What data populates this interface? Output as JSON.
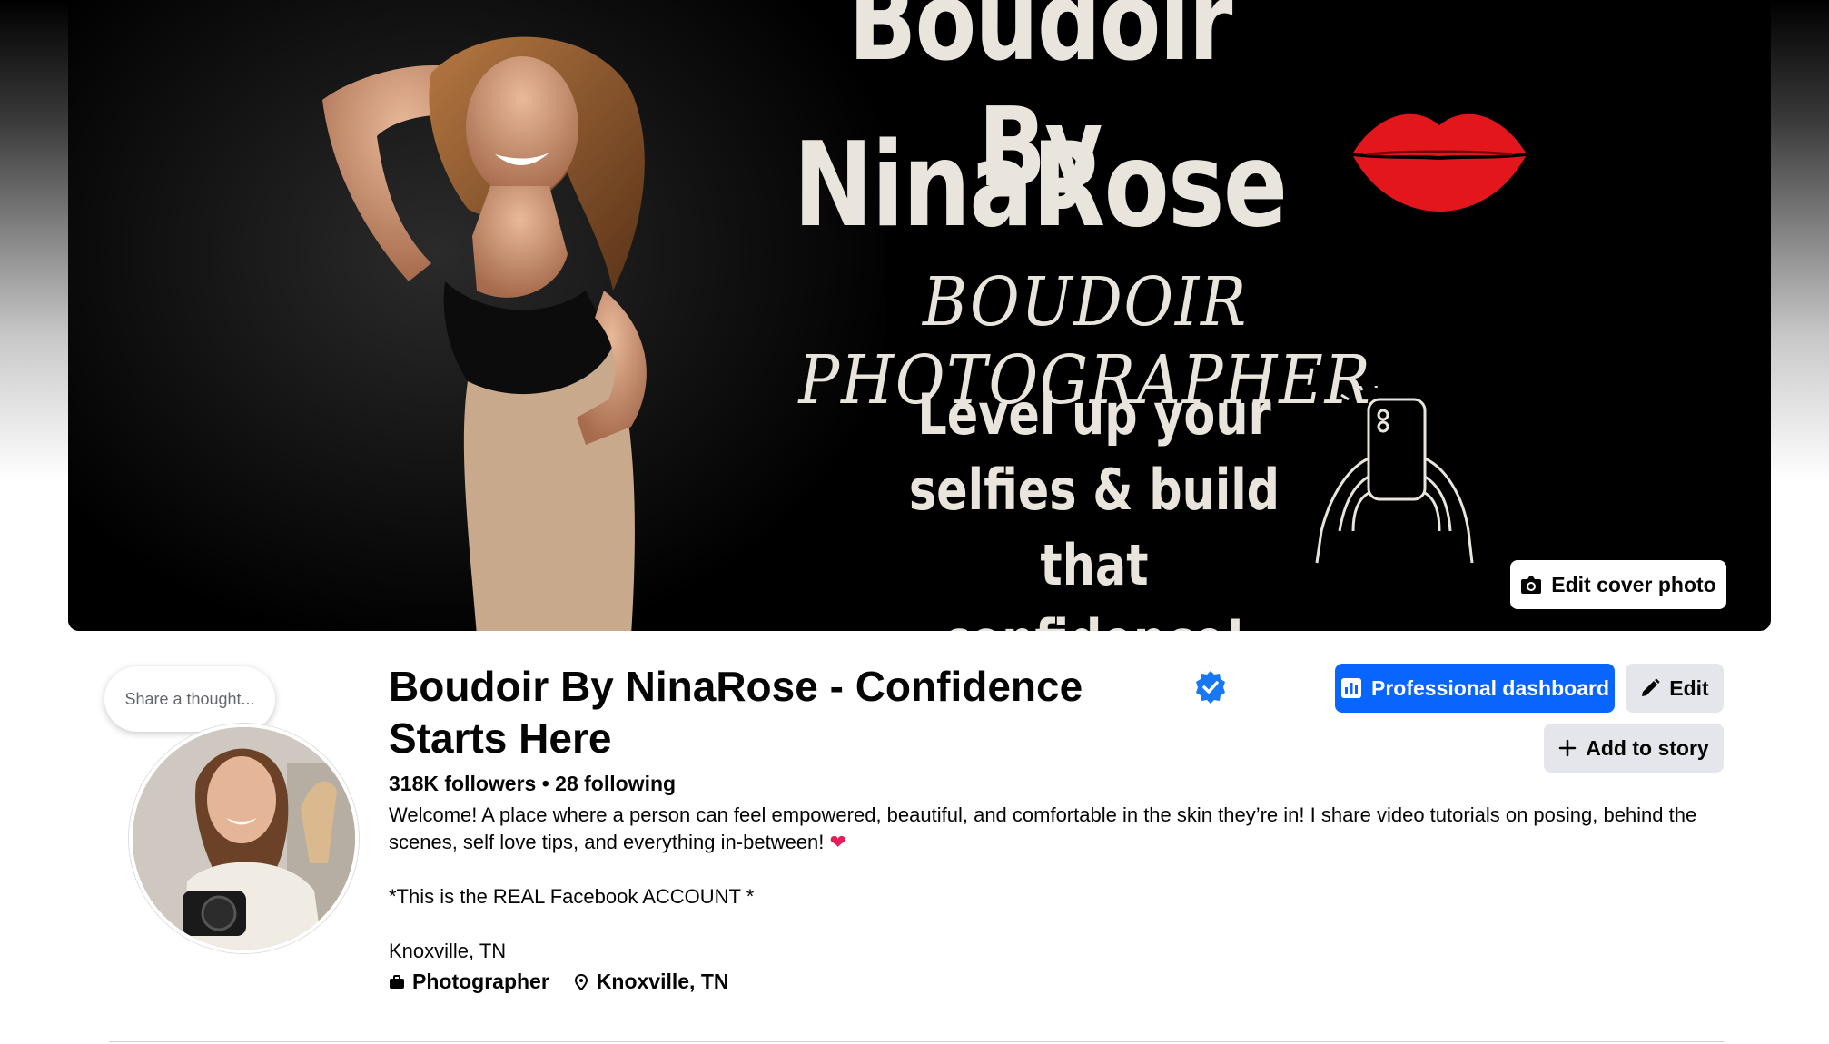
{
  "cover": {
    "title_line1": "Boudoir By",
    "title_line2": "NinaRose",
    "subtitle": "BOUDOIR PHOTOGRAPHER",
    "tagline_line1": "Level up your",
    "tagline_line2": "selfies & build that",
    "tagline_line3": "confidence!",
    "edit_cover_label": "Edit cover photo"
  },
  "profile": {
    "thought_placeholder": "Share a thought...",
    "name": "Boudoir By NinaRose - Confidence Starts Here",
    "verified_icon": "verified-badge-icon",
    "follow_stats": "318K followers • 28 following",
    "bio_line1": "Welcome! A place where a person can feel empowered, beautiful, and comfortable in the skin they’re in! I share video tutorials on posing, behind the scenes, self love tips, and everything in-between!",
    "bio_heart": "❤",
    "bio_line2": "*This is the REAL Facebook ACCOUNT *",
    "bio_line3": "Knoxville, TN",
    "category": "Photographer",
    "location": "Knoxville, TN"
  },
  "actions": {
    "professional_dashboard": "Professional dashboard",
    "edit": "Edit",
    "add_to_story": "Add to story"
  },
  "colors": {
    "primary": "#0866ff",
    "secondary_button": "#e4e6eb",
    "verified": "#1877f2",
    "heart": "#e41e5b"
  }
}
